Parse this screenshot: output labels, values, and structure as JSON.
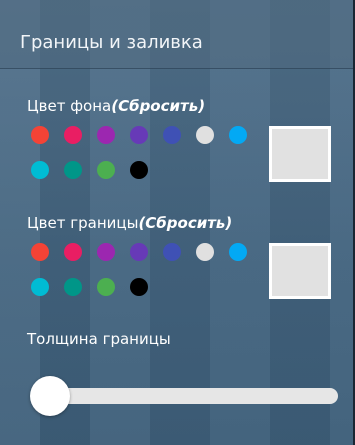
{
  "header": {
    "title": "Границы и заливка"
  },
  "background_color": {
    "label": "Цвет фона",
    "reset_label": "(Сбросить)",
    "preview_color": "#e1e1e1"
  },
  "border_color": {
    "label": "Цвет границы",
    "reset_label": "(Сбросить)",
    "preview_color": "#e1e1e1"
  },
  "swatches": [
    {
      "name": "red",
      "color": "#f44336"
    },
    {
      "name": "pink",
      "color": "#e91e63"
    },
    {
      "name": "purple",
      "color": "#9c27b0"
    },
    {
      "name": "deep-purple",
      "color": "#673ab7"
    },
    {
      "name": "indigo",
      "color": "#3f51b5"
    },
    {
      "name": "light-gray",
      "color": "#e0e0e0"
    },
    {
      "name": "blue",
      "color": "#03a9f4"
    },
    {
      "name": "cyan",
      "color": "#00bcd4"
    },
    {
      "name": "teal",
      "color": "#009688"
    },
    {
      "name": "green",
      "color": "#4caf50"
    },
    {
      "name": "black",
      "color": "#000000"
    }
  ],
  "border_width": {
    "label": "Толщина границы",
    "value_fraction": 0.0
  }
}
